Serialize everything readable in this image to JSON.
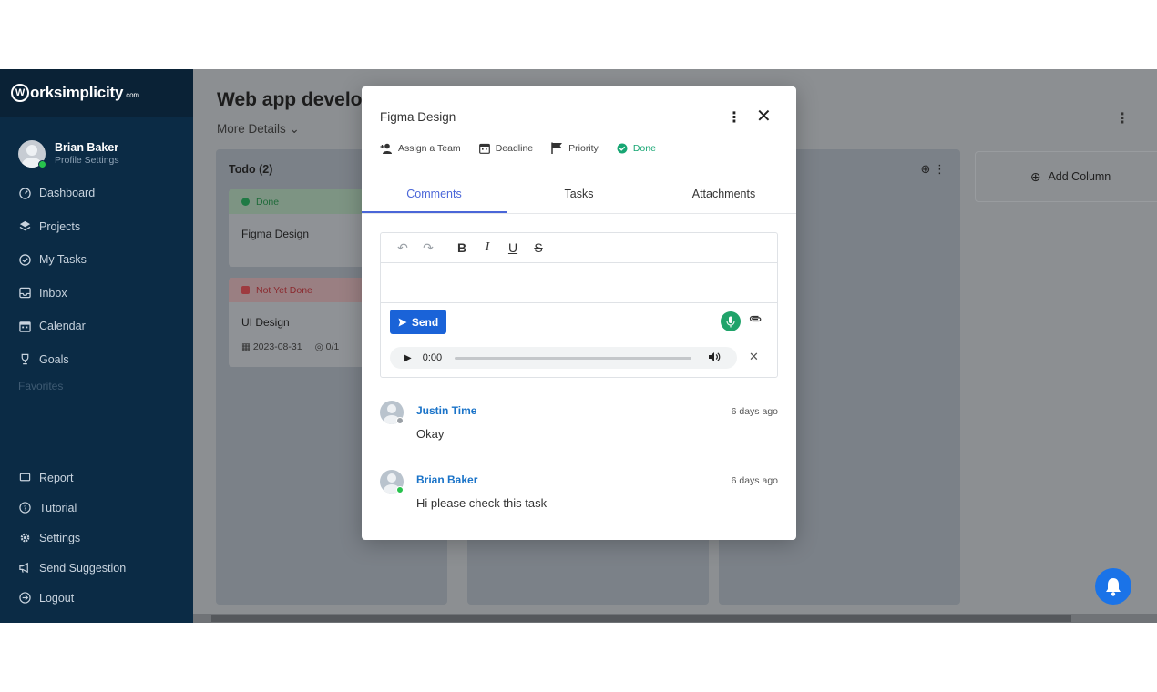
{
  "brand": {
    "name": "orksimplicity",
    "suffix": ".com",
    "logo_letter": "W"
  },
  "profile": {
    "name": "Brian Baker",
    "subtitle": "Profile Settings"
  },
  "nav": {
    "items": [
      {
        "label": "Dashboard",
        "icon": "dashboard-icon"
      },
      {
        "label": "Projects",
        "icon": "layers-icon"
      },
      {
        "label": "My Tasks",
        "icon": "check-circle-icon"
      },
      {
        "label": "Inbox",
        "icon": "inbox-icon"
      },
      {
        "label": "Calendar",
        "icon": "calendar-icon"
      },
      {
        "label": "Goals",
        "icon": "trophy-icon"
      }
    ],
    "favorites_label": "Favorites",
    "bottom_items": [
      {
        "label": "Report",
        "icon": "flag-outline-icon"
      },
      {
        "label": "Tutorial",
        "icon": "help-circle-icon"
      },
      {
        "label": "Settings",
        "icon": "gear-icon"
      },
      {
        "label": "Send Suggestion",
        "icon": "megaphone-icon"
      },
      {
        "label": "Logout",
        "icon": "logout-icon"
      }
    ]
  },
  "board": {
    "title": "Web app develop",
    "more_details": "More Details",
    "column1": {
      "title": "Todo (2)"
    },
    "cards": [
      {
        "status": "Done",
        "title": "Figma Design"
      },
      {
        "status": "Not Yet Done",
        "title": "UI Design",
        "date": "2023-08-31",
        "checklist": "0/1"
      }
    ],
    "add_column_label": "Add Column"
  },
  "modal": {
    "title": "Figma Design",
    "actions": {
      "assign": "Assign a Team",
      "deadline": "Deadline",
      "priority": "Priority",
      "status": "Done"
    },
    "tabs": [
      "Comments",
      "Tasks",
      "Attachments"
    ],
    "send_label": "Send",
    "audio_time": "0:00",
    "comments": [
      {
        "author": "Justin Time",
        "time": "6 days ago",
        "text": "Okay",
        "status_color": "#9aa0a6"
      },
      {
        "author": "Brian Baker",
        "time": "6 days ago",
        "text": "Hi please check this task",
        "status_color": "#27c24c"
      }
    ]
  },
  "colors": {
    "sidebar": "#0b2b45",
    "accent": "#4a66d8",
    "send": "#1a63d8",
    "done": "#17a673",
    "mic": "#20a36a"
  }
}
